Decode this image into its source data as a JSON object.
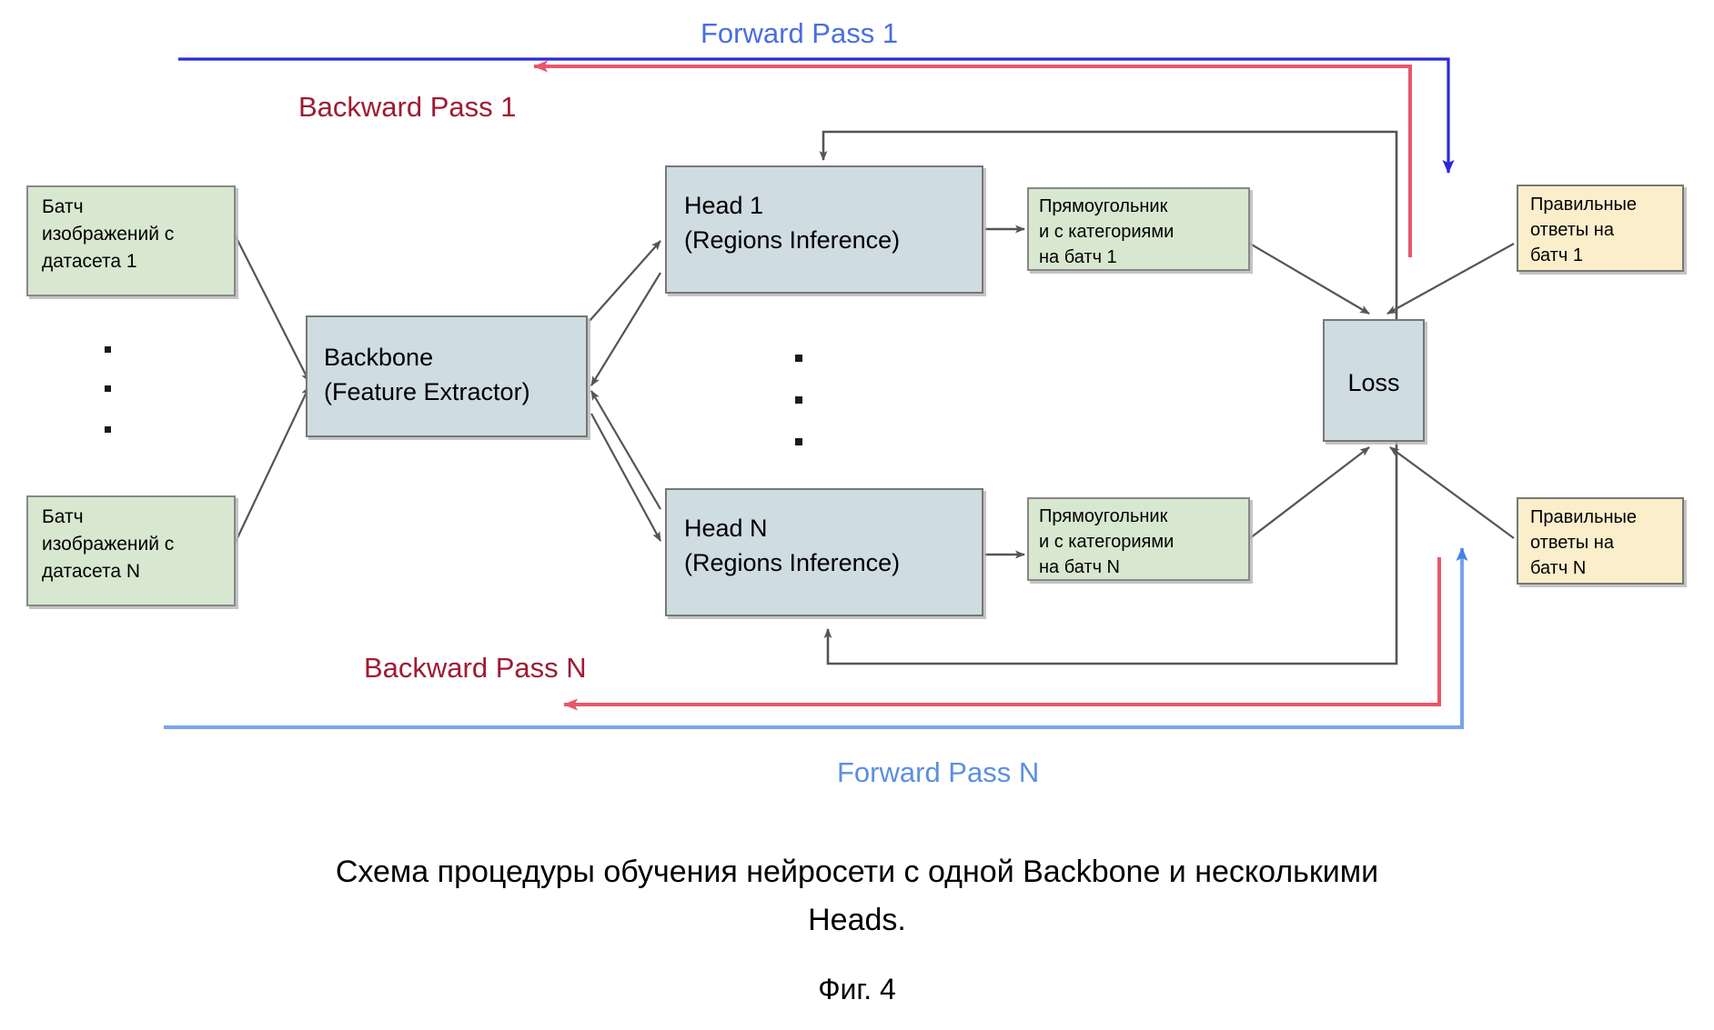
{
  "figure": {
    "caption_line1": "Схема процедуры обучения нейросети с одной Backbone и несколькими",
    "caption_line2": "Heads.",
    "figure_number": "Фиг. 4"
  },
  "colors": {
    "forward_pass_1": "#3b4fdb",
    "forward_pass_n": "#5b8fe0",
    "backward_pass": "#c8102e",
    "backward_label": "#9e1b32",
    "forward_label_1": "#4a6ee0",
    "forward_label_n": "#5b8fe0",
    "green_fill": "#d8e7d0",
    "blue_fill": "#cfdce2",
    "yellow_fill": "#faeecb",
    "box_stroke": "#666666",
    "connector": "#555555"
  },
  "pass_labels": {
    "forward_1": "Forward Pass 1",
    "backward_1": "Backward Pass 1",
    "backward_n": "Backward Pass N",
    "forward_n": "Forward Pass N"
  },
  "nodes": {
    "batch_1": {
      "lines": [
        "Батч",
        "изображений с",
        "датасета 1"
      ]
    },
    "batch_n": {
      "lines": [
        "Батч",
        "изображений с",
        "датасета N"
      ]
    },
    "backbone": {
      "lines": [
        "Backbone",
        "(Feature Extractor)"
      ]
    },
    "head_1": {
      "lines": [
        "Head 1",
        "(Regions Inference)"
      ]
    },
    "head_n": {
      "lines": [
        "Head N",
        "(Regions Inference)"
      ]
    },
    "pred_1": {
      "lines": [
        "Прямоугольник",
        "и с категориями",
        "на батч 1"
      ]
    },
    "pred_n": {
      "lines": [
        "Прямоугольник",
        "и с категориями",
        "на батч N"
      ]
    },
    "gt_1": {
      "lines": [
        "Правильные",
        "ответы на",
        "батч 1"
      ]
    },
    "gt_n": {
      "lines": [
        "Правильные",
        "ответы на",
        "батч N"
      ]
    },
    "loss": {
      "lines": [
        "Loss"
      ]
    }
  },
  "ellipsis": {
    "left_dots": "·",
    "middle_dots": "·"
  }
}
